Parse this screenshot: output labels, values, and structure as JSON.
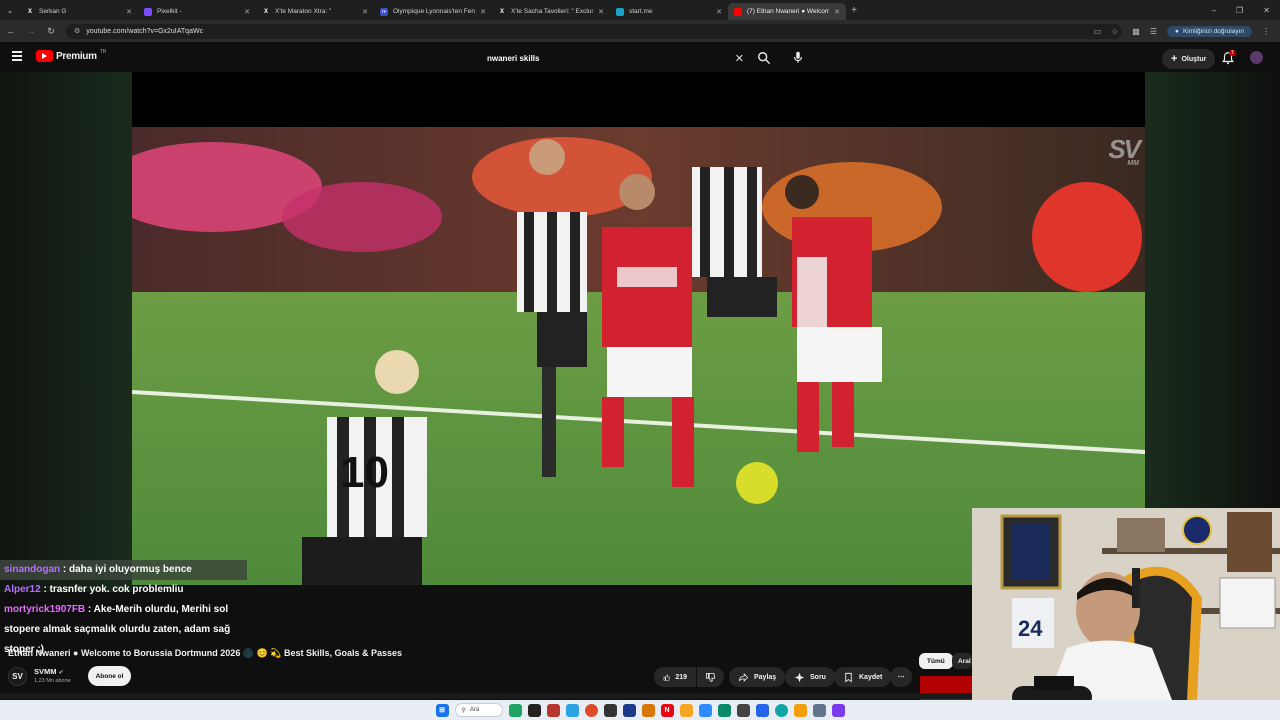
{
  "browser": {
    "tabs": [
      {
        "title": "Serkan G",
        "favicon": "x-icon",
        "active": false
      },
      {
        "title": "Pixelkit -",
        "favicon": "pixelkit-icon",
        "active": false
      },
      {
        "title": "X'te Maraton Xtra: \"",
        "favicon": "x-icon",
        "active": false
      },
      {
        "title": "Olympique Lyonnais'ten Fenerb",
        "favicon": "tf-icon",
        "active": false
      },
      {
        "title": "X'te Sacha Tavolieri: \" Exclus",
        "favicon": "x-icon",
        "active": false
      },
      {
        "title": "start.me",
        "favicon": "startme-icon",
        "active": false
      },
      {
        "title": "(7) Ethan Nwaneri ● Welcome",
        "favicon": "youtube-icon",
        "active": true
      }
    ],
    "url": "youtube.com/watch?v=Gx2uIATqaWc",
    "profile_label": "Kimliğinizi doğrulayın"
  },
  "youtube": {
    "brand": "Premium",
    "region": "TR",
    "search_query": "nwaneri skills",
    "create_label": "Oluştur",
    "notification_count": "7"
  },
  "video": {
    "title": "Ethan Nwaneri ● Welcome to Borussia Dortmund 2026 🌑 😊 💫 Best Skills, Goals & Passes",
    "channel_name": "SVMM",
    "channel_initials": "SV",
    "subscribers": "1,23 Mn abone",
    "subscribe_label": "Abone ol",
    "likes": "219",
    "share_label": "Paylaş",
    "ask_label": "Soru",
    "save_label": "Kaydet",
    "watermark": "SV",
    "watermark_sub": "MM"
  },
  "chips": {
    "all": "Tümü",
    "related": "Aral"
  },
  "chat": [
    {
      "user": "sinandogan",
      "message": "daha iyi oluyormuş bence"
    },
    {
      "user": "Alper12",
      "message": "trasnfer yok. cok problemliu"
    },
    {
      "user": "mortyrick1907FB",
      "message": "Ake-Merih olurdu, Merihi sol stopere almak saçmalık olurdu zaten, adam sağ stoper :)"
    }
  ],
  "taskbar": {
    "search_label": "Ara"
  }
}
